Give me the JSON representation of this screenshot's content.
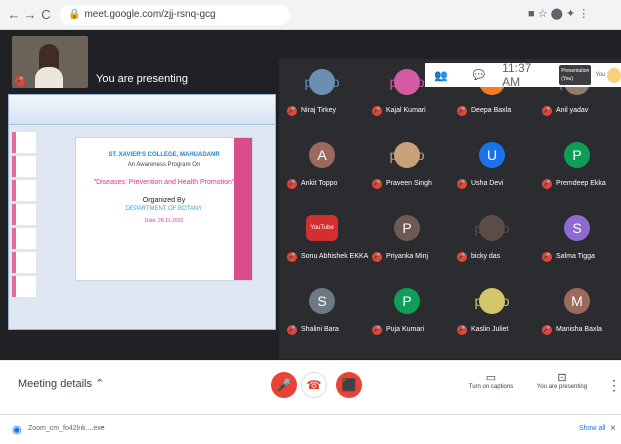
{
  "browser": {
    "url": "meet.google.com/zjj-rsnq-gcg"
  },
  "topbar": {
    "time": "11:37 AM",
    "chip_top": "Presentation",
    "chip_bottom": "(You)",
    "chip_you": "You"
  },
  "presenter": {
    "label": "You are presenting"
  },
  "slide": {
    "college": "ST. XAVIER'S COLLEGE, MAHUADANR",
    "program": "An Awareness Program On",
    "topic": "\"Diseases: Prevention and Health Promotion\"",
    "organized": "Organized By",
    "department": "DEPARTMENT OF BOTANY",
    "date": "Date: 28-11-2020"
  },
  "participants": [
    {
      "name": "Niraj Tirkey",
      "avatar": "photo",
      "color": "#6b8fb2"
    },
    {
      "name": "Kajal Kumari",
      "avatar": "photo",
      "color": "#d55aa5"
    },
    {
      "name": "Deepa Baxla",
      "avatar": "D",
      "color": "#f57c24"
    },
    {
      "name": "Anil yadav",
      "avatar": "photo",
      "color": "#8d7d69"
    },
    {
      "name": "Ankit Toppo",
      "avatar": "A",
      "color": "#9b6a5c"
    },
    {
      "name": "Praveen Singh",
      "avatar": "photo",
      "color": "#c8a17b"
    },
    {
      "name": "Usha Devi",
      "avatar": "U",
      "color": "#1a73e8"
    },
    {
      "name": "Premdeep Ekka",
      "avatar": "P",
      "color": "#0f9d58"
    },
    {
      "name": "Sonu Abhishek EKKA",
      "avatar": "YouTube",
      "color": "#d32f2f"
    },
    {
      "name": "Priyanka Minj",
      "avatar": "P",
      "color": "#6d5a53"
    },
    {
      "name": "bicky das",
      "avatar": "photo",
      "color": "#5a4c46"
    },
    {
      "name": "Salma Tigga",
      "avatar": "S",
      "color": "#8e6ad1"
    },
    {
      "name": "Shalini Bara",
      "avatar": "S",
      "color": "#6d7a83"
    },
    {
      "name": "Puja Kumari",
      "avatar": "P",
      "color": "#0f9d58"
    },
    {
      "name": "Kaslin Juliet",
      "avatar": "photo",
      "color": "#d4c66b"
    },
    {
      "name": "Manisha Baxla",
      "avatar": "M",
      "color": "#9b6a5c"
    }
  ],
  "bottom": {
    "meeting_details": "Meeting details",
    "captions": "Turn on captions",
    "presenting": "You are presenting",
    "more": "⋮"
  },
  "download": {
    "file": "Zoom_cm_fo42lnk....exe",
    "showall": "Show all"
  }
}
